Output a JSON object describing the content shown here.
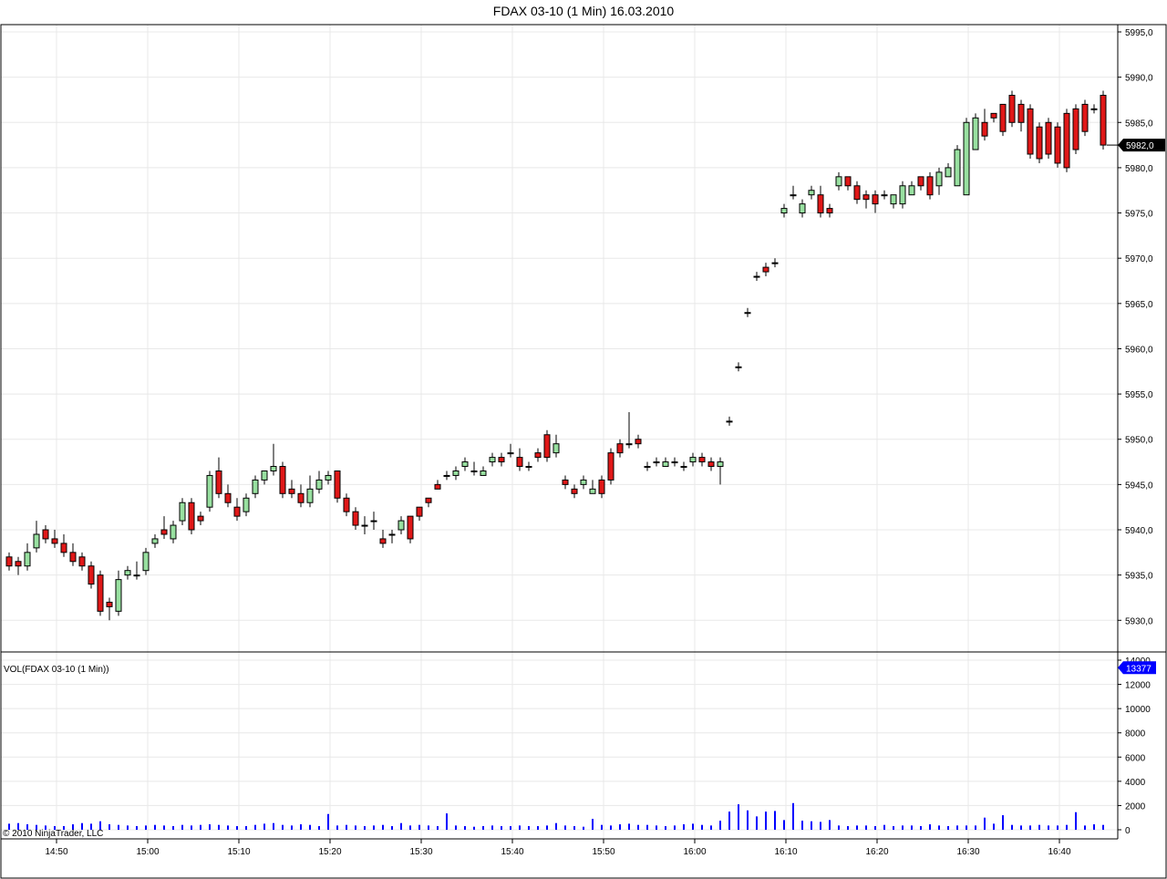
{
  "title": "FDAX 03-10 (1 Min)  16.03.2010",
  "volume_panel_label": "VOL(FDAX 03-10 (1 Min))",
  "copyright": "© 2010 NinjaTrader, LLC",
  "current_price_label": "5982,0",
  "current_volume_label": "13377",
  "colors": {
    "up": "#98e0a0",
    "down": "#e01818",
    "volume": "#0000ff",
    "price_marker": "#000000",
    "volume_marker": "#0000ff"
  },
  "chart_data": [
    {
      "type": "candlestick",
      "price_ylim": [
        5926,
        5995
      ],
      "y_ticks": [
        "5930,0",
        "5935,0",
        "5940,0",
        "5945,0",
        "5950,0",
        "5955,0",
        "5960,0",
        "5965,0",
        "5970,0",
        "5975,0",
        "5980,0",
        "5985,0",
        "5990,0",
        "5995,0"
      ],
      "y_tick_values": [
        5930,
        5935,
        5940,
        5945,
        5950,
        5955,
        5960,
        5965,
        5970,
        5975,
        5980,
        5985,
        5990,
        5995
      ],
      "x_ticks": [
        "14:50",
        "15:00",
        "15:10",
        "15:20",
        "15:30",
        "15:40",
        "15:50",
        "16:00",
        "16:10",
        "16:20",
        "16:30",
        "16:40"
      ],
      "x_tick_minutes": [
        5,
        15,
        25,
        35,
        45,
        55,
        65,
        75,
        85,
        95,
        105,
        115
      ],
      "start_time": "14:45",
      "minutes": [
        0,
        1,
        2,
        3,
        4,
        5,
        6,
        7,
        8,
        9,
        10,
        11,
        12,
        13,
        14,
        15,
        16,
        17,
        18,
        19,
        20,
        21,
        22,
        23,
        24,
        25,
        26,
        27,
        28,
        29,
        30,
        31,
        32,
        33,
        34,
        35,
        36,
        37,
        38,
        39,
        40,
        41,
        42,
        43,
        44,
        45,
        46,
        47,
        48,
        49,
        50,
        51,
        52,
        53,
        54,
        55,
        56,
        57,
        58,
        59,
        60,
        61,
        62,
        63,
        64,
        65,
        66,
        67,
        68,
        69,
        70,
        71,
        72,
        73,
        74,
        75,
        76,
        77,
        78,
        79,
        80,
        81,
        82,
        83,
        84,
        85,
        86,
        87,
        88,
        89,
        90,
        91,
        92,
        93,
        94,
        95,
        96,
        97,
        98,
        99,
        100,
        101,
        102,
        103,
        104,
        105,
        106,
        107,
        108,
        109,
        110,
        111,
        112,
        113,
        114,
        115,
        116,
        117,
        118,
        119,
        120
      ],
      "open": [
        5937.0,
        5936.5,
        5936.0,
        5938.0,
        5940.0,
        5939.0,
        5938.5,
        5937.5,
        5937.0,
        5936.0,
        5935.0,
        5932.0,
        5931.0,
        5935.0,
        5935.0,
        5935.5,
        5938.5,
        5940.0,
        5939.0,
        5941.0,
        5943.0,
        5941.5,
        5942.5,
        5946.5,
        5944.0,
        5942.5,
        5942.0,
        5944.0,
        5945.5,
        5946.5,
        5947.0,
        5944.5,
        5944.0,
        5943.0,
        5944.5,
        5945.5,
        5946.5,
        5943.5,
        5942.0,
        5940.5,
        5941.0,
        5939.0,
        5939.5,
        5940.0,
        5941.5,
        5942.5,
        5943.5,
        5945.0,
        5946.0,
        5946.0,
        5947.0,
        5946.5,
        5946.0,
        5947.5,
        5948.0,
        5948.5,
        5948.0,
        5947.0,
        5948.5,
        5950.5,
        5948.5,
        5945.5,
        5944.5,
        5945.0,
        5944.0,
        5945.5,
        5948.5,
        5949.5,
        5949.5,
        5950.0,
        5947.0,
        5947.5,
        5947.0,
        5947.5,
        5947.0,
        5947.5,
        5948.0,
        5947.5,
        5947.0,
        5952.0,
        5958.0,
        5964.0,
        5968.0,
        5969.0,
        5969.5,
        5975.0,
        5977.0,
        5975.0,
        5977.0,
        5977.0,
        5975.5,
        5978.0,
        5979.0,
        5978.0,
        5977.0,
        5977.0,
        5977.0,
        5976.0,
        5976.0,
        5977.0,
        5979.0,
        5979.0,
        5978.0,
        5979.0,
        5978.0,
        5977.0,
        5982.0,
        5985.0,
        5986.0,
        5987.0,
        5988.0,
        5987.0,
        5986.5,
        5984.5,
        5985.0,
        5984.5,
        5986.0,
        5986.5,
        5987.0,
        5986.5,
        5988.0
      ],
      "close": [
        5936.0,
        5936.0,
        5937.5,
        5939.5,
        5939.0,
        5938.5,
        5937.5,
        5936.5,
        5936.0,
        5934.0,
        5931.0,
        5931.5,
        5934.5,
        5935.5,
        5935.0,
        5937.5,
        5939.0,
        5939.5,
        5940.5,
        5943.0,
        5940.0,
        5941.0,
        5946.0,
        5944.0,
        5943.0,
        5941.5,
        5943.5,
        5945.5,
        5946.5,
        5947.0,
        5944.0,
        5944.0,
        5943.0,
        5944.5,
        5945.5,
        5946.0,
        5943.5,
        5942.0,
        5940.5,
        5940.5,
        5941.0,
        5938.5,
        5939.5,
        5941.0,
        5939.0,
        5941.5,
        5943.0,
        5944.5,
        5946.0,
        5946.5,
        5947.5,
        5946.5,
        5946.5,
        5948.0,
        5947.5,
        5948.5,
        5947.0,
        5947.0,
        5948.0,
        5948.0,
        5949.5,
        5945.0,
        5944.0,
        5945.5,
        5944.5,
        5944.0,
        5945.5,
        5948.5,
        5949.5,
        5949.5,
        5947.0,
        5947.5,
        5947.5,
        5947.5,
        5947.0,
        5948.0,
        5947.5,
        5947.0,
        5947.5,
        5952.0,
        5958.0,
        5964.0,
        5968.0,
        5968.5,
        5969.5,
        5975.5,
        5977.0,
        5976.0,
        5977.5,
        5975.0,
        5975.0,
        5979.0,
        5978.0,
        5976.5,
        5976.5,
        5976.0,
        5977.0,
        5977.0,
        5978.0,
        5978.0,
        5978.0,
        5977.0,
        5979.5,
        5980.0,
        5982.0,
        5985.0,
        5985.5,
        5983.5,
        5985.5,
        5984.0,
        5985.0,
        5985.0,
        5981.5,
        5981.0,
        5981.5,
        5980.5,
        5980.0,
        5982.0,
        5984.0,
        5986.5,
        5982.5
      ],
      "high": [
        5937.5,
        5937.0,
        5938.5,
        5941.0,
        5940.5,
        5940.0,
        5939.5,
        5938.5,
        5937.5,
        5936.5,
        5935.5,
        5932.5,
        5935.5,
        5936.0,
        5936.5,
        5938.0,
        5939.5,
        5941.5,
        5941.0,
        5943.5,
        5943.5,
        5942.0,
        5946.5,
        5948.0,
        5945.0,
        5943.5,
        5944.0,
        5946.0,
        5946.5,
        5949.5,
        5947.5,
        5945.5,
        5945.0,
        5946.0,
        5946.5,
        5946.5,
        5946.5,
        5944.0,
        5942.5,
        5941.5,
        5942.0,
        5940.0,
        5940.0,
        5941.5,
        5941.5,
        5942.0,
        5943.5,
        5945.5,
        5946.5,
        5947.0,
        5948.0,
        5947.5,
        5947.0,
        5948.5,
        5948.5,
        5949.5,
        5949.0,
        5947.5,
        5949.0,
        5951.0,
        5950.5,
        5946.0,
        5945.0,
        5946.0,
        5945.5,
        5946.0,
        5949.0,
        5950.0,
        5953.0,
        5950.5,
        5947.5,
        5948.0,
        5948.0,
        5948.0,
        5947.5,
        5948.5,
        5948.5,
        5948.0,
        5948.0,
        5952.5,
        5958.5,
        5964.5,
        5968.5,
        5969.5,
        5970.0,
        5976.0,
        5978.0,
        5976.5,
        5978.0,
        5978.0,
        5976.0,
        5979.5,
        5979.0,
        5978.5,
        5977.5,
        5977.5,
        5977.5,
        5977.0,
        5978.5,
        5978.5,
        5979.0,
        5979.5,
        5980.0,
        5980.5,
        5982.5,
        5985.5,
        5986.0,
        5986.5,
        5986.0,
        5987.0,
        5988.5,
        5987.5,
        5987.0,
        5985.0,
        5985.5,
        5985.0,
        5986.5,
        5987.0,
        5987.5,
        5987.0,
        5988.5
      ],
      "low": [
        5935.5,
        5935.0,
        5935.5,
        5937.5,
        5938.5,
        5938.0,
        5937.0,
        5936.0,
        5935.5,
        5933.5,
        5930.5,
        5930.0,
        5930.5,
        5934.5,
        5934.5,
        5935.0,
        5938.0,
        5939.0,
        5938.5,
        5940.5,
        5939.5,
        5940.5,
        5942.0,
        5943.5,
        5942.5,
        5941.0,
        5941.5,
        5943.5,
        5945.0,
        5946.0,
        5943.5,
        5943.5,
        5942.5,
        5942.5,
        5944.0,
        5945.0,
        5943.0,
        5941.5,
        5940.0,
        5939.5,
        5940.0,
        5938.0,
        5938.5,
        5939.5,
        5938.5,
        5941.0,
        5942.5,
        5944.5,
        5945.5,
        5945.5,
        5946.5,
        5946.0,
        5946.0,
        5947.0,
        5947.0,
        5948.0,
        5946.5,
        5946.5,
        5947.5,
        5947.5,
        5948.0,
        5944.5,
        5943.5,
        5944.5,
        5944.0,
        5943.5,
        5945.0,
        5948.0,
        5949.0,
        5949.0,
        5946.5,
        5947.0,
        5947.0,
        5947.0,
        5946.5,
        5947.0,
        5947.0,
        5946.5,
        5945.0,
        5951.5,
        5957.5,
        5963.5,
        5967.5,
        5968.0,
        5969.0,
        5974.5,
        5976.5,
        5974.5,
        5976.5,
        5974.5,
        5974.5,
        5977.5,
        5977.5,
        5976.0,
        5975.5,
        5975.0,
        5976.5,
        5975.5,
        5975.5,
        5977.0,
        5977.5,
        5976.5,
        5977.0,
        5979.0,
        5981.5,
        5984.0,
        5985.0,
        5983.0,
        5985.0,
        5983.5,
        5984.5,
        5984.0,
        5981.0,
        5980.5,
        5981.0,
        5980.0,
        5979.5,
        5981.5,
        5983.5,
        5986.0,
        5982.0
      ]
    },
    {
      "type": "bar",
      "volume_ylim": [
        0,
        14000
      ],
      "y_ticks": [
        "0",
        "2000",
        "4000",
        "6000",
        "8000",
        "10000",
        "12000",
        "14000"
      ],
      "y_tick_values": [
        0,
        2000,
        4000,
        6000,
        8000,
        10000,
        12000,
        14000
      ],
      "volume": [
        500,
        550,
        450,
        400,
        350,
        300,
        300,
        450,
        550,
        500,
        700,
        450,
        400,
        350,
        300,
        350,
        400,
        350,
        300,
        400,
        350,
        400,
        450,
        400,
        350,
        300,
        300,
        400,
        500,
        550,
        400,
        350,
        450,
        400,
        300,
        1300,
        350,
        400,
        350,
        300,
        350,
        400,
        300,
        550,
        350,
        400,
        350,
        300,
        1350,
        350,
        300,
        250,
        300,
        350,
        300,
        300,
        350,
        300,
        300,
        350,
        550,
        350,
        300,
        250,
        900,
        400,
        350,
        450,
        500,
        400,
        400,
        350,
        300,
        350,
        450,
        500,
        400,
        350,
        750,
        1500,
        2100,
        1600,
        1100,
        1500,
        1550,
        800,
        2200,
        750,
        700,
        650,
        800,
        350,
        300,
        350,
        350,
        300,
        400,
        300,
        350,
        350,
        300,
        450,
        350,
        300,
        350,
        350,
        350,
        1000,
        500,
        1200,
        400,
        350,
        350,
        400,
        350,
        350,
        400,
        1450,
        350,
        450,
        400
      ],
      "last_volume": 13377
    }
  ]
}
